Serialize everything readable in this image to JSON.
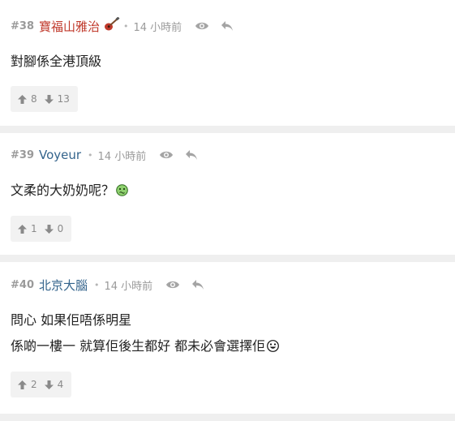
{
  "posts": [
    {
      "number": "#38",
      "author": "寶福山雅治",
      "time": "14 小時前",
      "lines": [
        "對腳係全港頂級"
      ],
      "upvotes": "8",
      "downvotes": "13"
    },
    {
      "number": "#39",
      "author": "Voyeur",
      "time": "14 小時前",
      "lines": [
        "文柔的大奶奶呢？"
      ],
      "upvotes": "1",
      "downvotes": "0"
    },
    {
      "number": "#40",
      "author": "北京大腦",
      "time": "14 小時前",
      "lines": [
        "問心 如果佢唔係明星",
        "係啲一樓一 就算佢後生都好 都未必會選擇佢"
      ],
      "upvotes": "2",
      "downvotes": "4"
    }
  ],
  "colors": {
    "author_red": "#c0392b",
    "author_blue": "#34648c",
    "background": "#efefef"
  },
  "icons": [
    "eye-icon",
    "reply-arrow-icon",
    "thumb-up-arrow-icon",
    "thumb-down-arrow-icon",
    "guitar-icon",
    "sick-emoji-icon",
    "grin-emoji-icon"
  ]
}
